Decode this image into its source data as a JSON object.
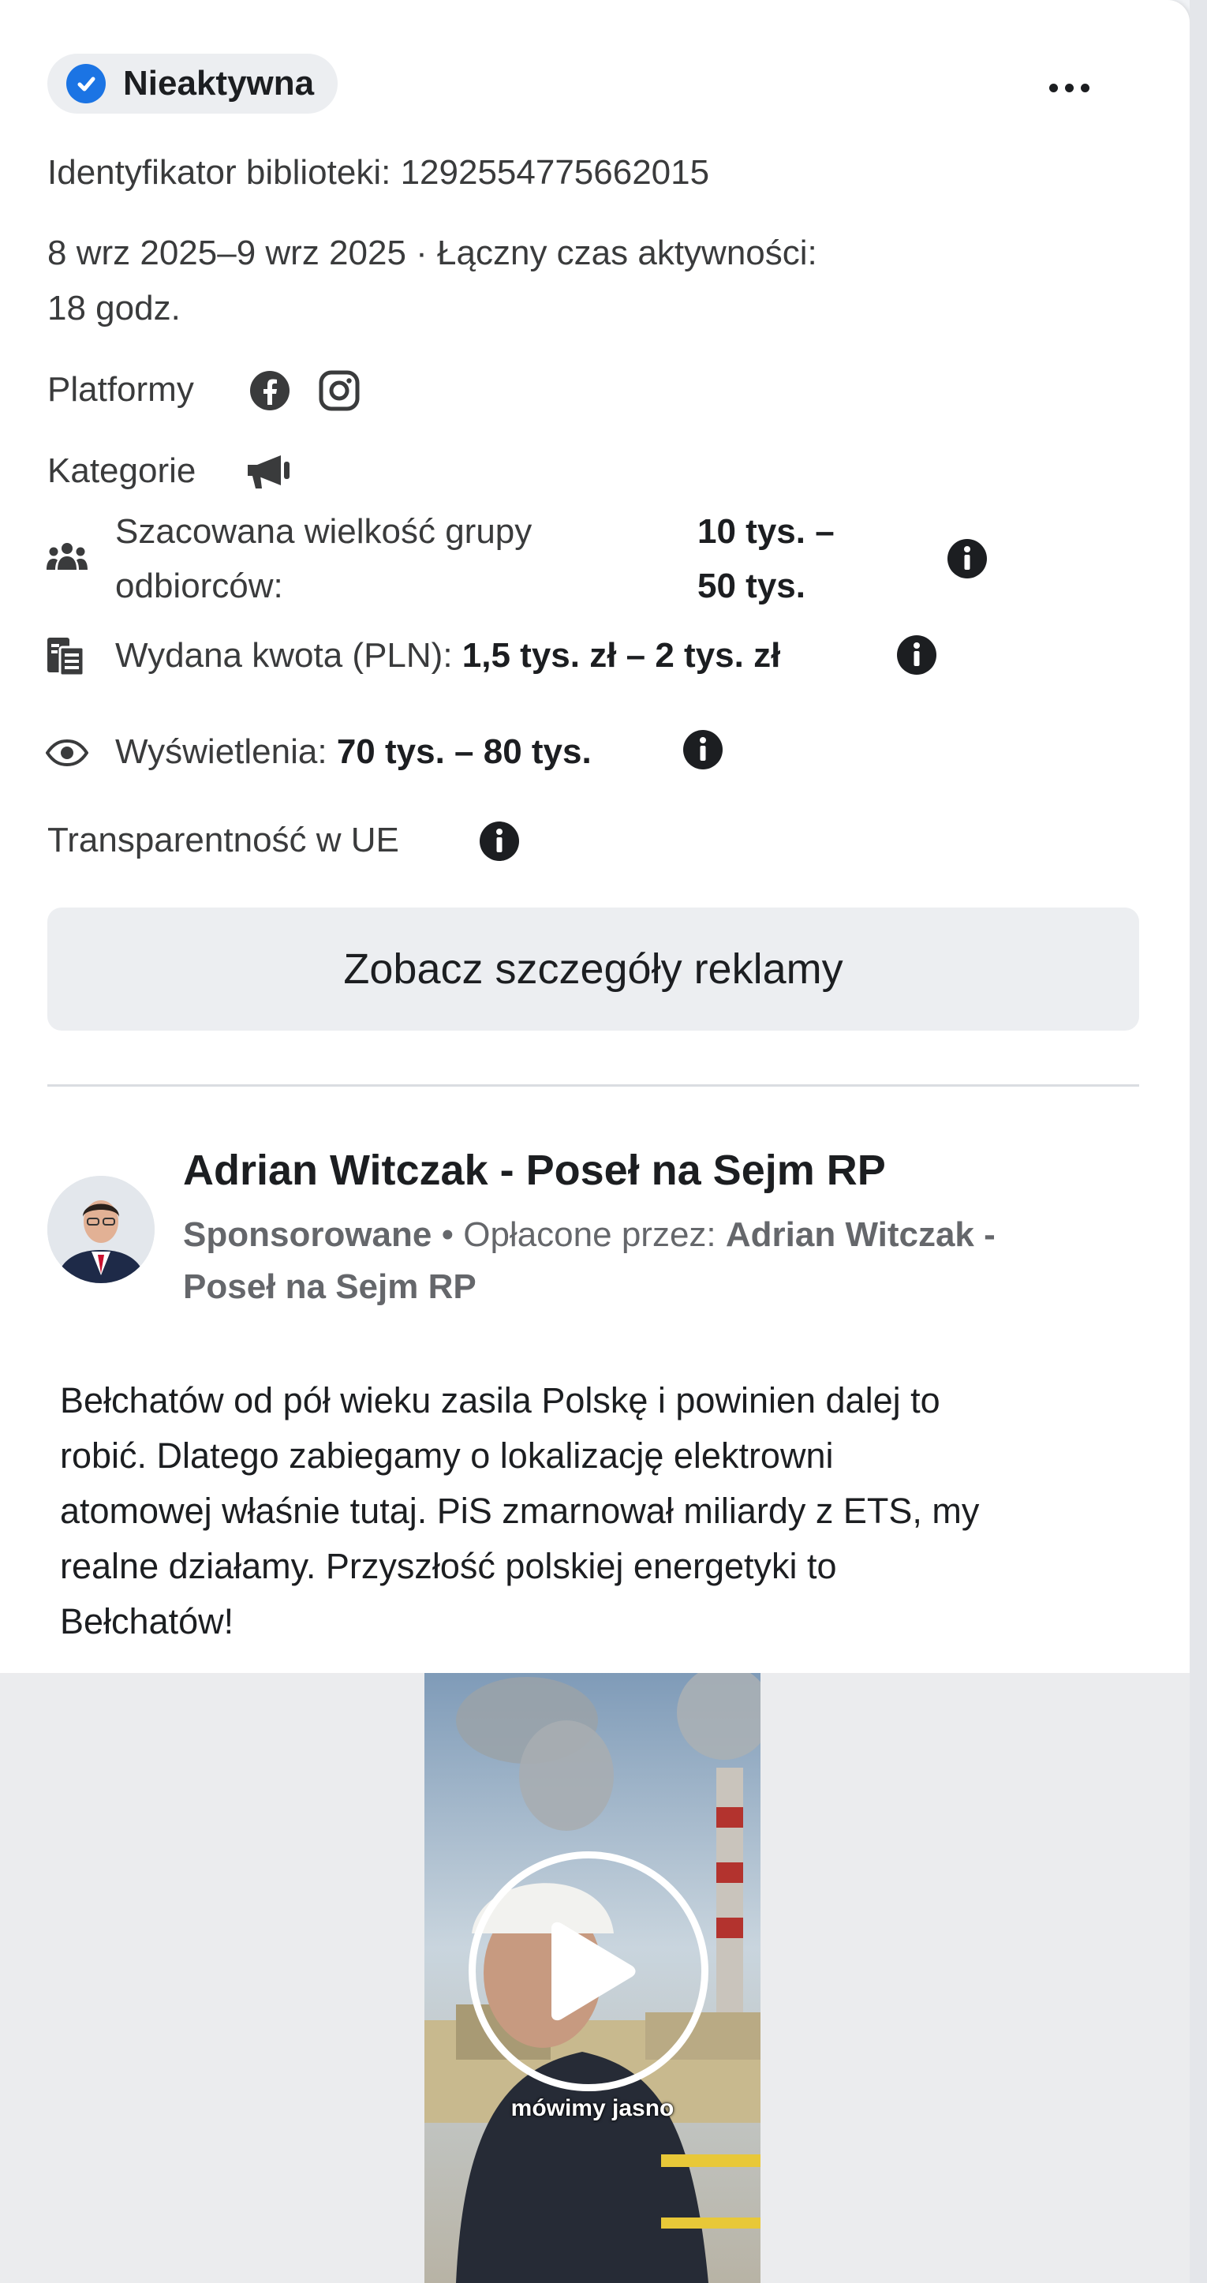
{
  "status": {
    "label": "Nieaktywna",
    "icon": "check-circle-icon",
    "accent": "#1b74e4"
  },
  "menu": {
    "icon": "more-dots-icon"
  },
  "library_id": "Identyfikator biblioteki: 1292554775662015",
  "dates": {
    "line1": "8 wrz 2025–9 wrz 2025 · Łączny czas aktywności:",
    "line2": "18 godz."
  },
  "platforms": {
    "label": "Platformy",
    "icons": [
      "facebook-icon",
      "instagram-icon"
    ]
  },
  "categories": {
    "label": "Kategorie",
    "icon": "megaphone-icon"
  },
  "audience": {
    "label_line1": "Szacowana wielkość grupy",
    "label_line2": "odbiorców:",
    "value_line1": "10 tys. –",
    "value_line2": "50 tys."
  },
  "spend": {
    "label": "Wydana kwota (PLN):",
    "value": "1,5 tys. zł – 2 tys. zł"
  },
  "impressions": {
    "label": "Wyświetlenia:",
    "value": "70 tys. – 80 tys."
  },
  "eu_transparency": {
    "label": "Transparentność w UE"
  },
  "details_button": "Zobacz szczegóły reklamy",
  "advertiser": {
    "name": "Adrian Witczak - Poseł na Sejm RP",
    "sponsored": "Sponsorowane",
    "paid_by_prefix": "• Opłacone przez:",
    "paid_by_line1": "Adrian Witczak -",
    "paid_by_line2": "Poseł na Sejm RP"
  },
  "ad_text": [
    "Bełchatów od pół wieku zasila Polskę i powinien dalej to",
    "robić. Dlatego zabiegamy o lokalizację elektrowni",
    "atomowej właśnie tutaj. PiS zmarnował miliardy z ETS, my",
    "realne działamy. Przyszłość polskiej energetyki to",
    "Bełchatów!"
  ],
  "video": {
    "caption": "mówimy jasno",
    "icon": "play-icon"
  }
}
